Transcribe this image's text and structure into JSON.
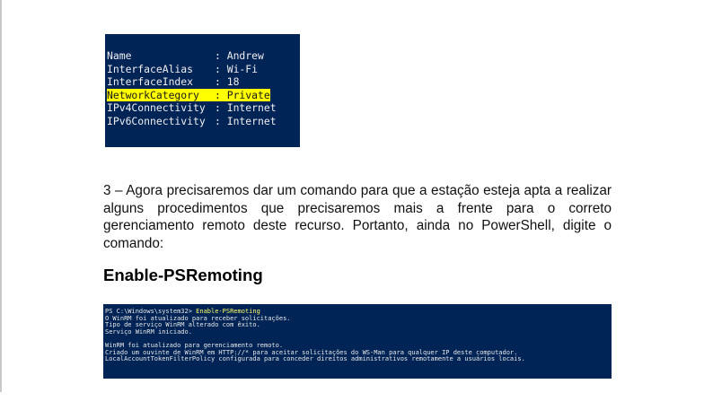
{
  "terminal1": {
    "rows": [
      {
        "key": "Name",
        "sep": ": ",
        "value": "Andrew",
        "highlighted": false
      },
      {
        "key": "InterfaceAlias",
        "sep": ": ",
        "value": "Wi-Fi",
        "highlighted": false
      },
      {
        "key": "InterfaceIndex",
        "sep": ": ",
        "value": "18",
        "highlighted": false
      },
      {
        "key": "NetworkCategory",
        "sep": ": ",
        "value": "Private",
        "highlighted": true
      },
      {
        "key": "IPv4Connectivity",
        "sep": ": ",
        "value": "Internet",
        "highlighted": false
      },
      {
        "key": "IPv6Connectivity",
        "sep": ": ",
        "value": "Internet",
        "highlighted": false
      }
    ]
  },
  "step3": {
    "text": "3 – Agora precisaremos dar um comando para que a estação esteja apta a realizar alguns procedimentos que precisaremos mais a frente para o correto gerenciamento remoto deste recurso. Portanto, ainda no PowerShell, digite o comando:"
  },
  "command_heading": "Enable-PSRemoting",
  "terminal2": {
    "prompt": "PS C:\\Windows\\system32> ",
    "command": "Enable-PSRemoting",
    "line1": "O WinRM foi atualizado para receber solicitações.",
    "line2": "Tipo de serviço WinRM alterado com êxito.",
    "line3": "Serviço WinRM iniciado.",
    "line4": "WinRM foi atualizado para gerenciamento remoto.",
    "line5": "Criado um ouvinte de WinRM em HTTP://* para aceitar solicitações do WS-Man para qualquer IP deste computador.",
    "line6": "LocalAccountTokenFilterPolicy configurada para conceder direitos administrativos remotamente a usuários locais."
  }
}
